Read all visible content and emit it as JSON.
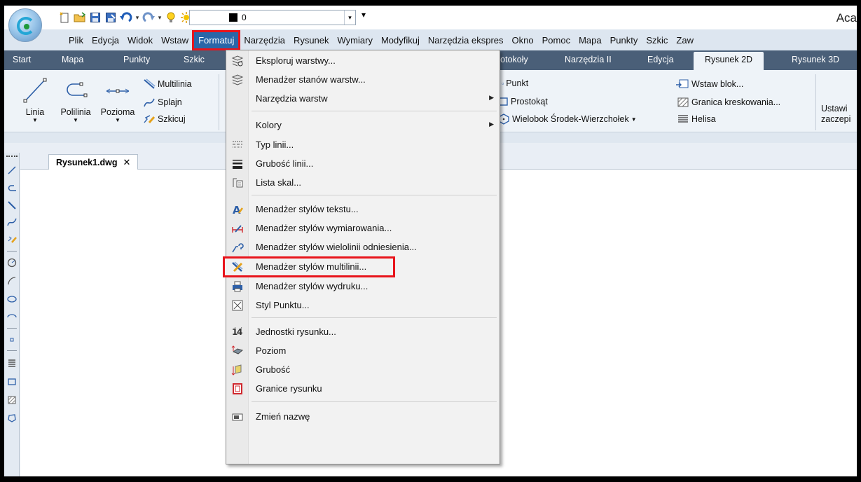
{
  "app": {
    "title": "Aca",
    "layer_value": "0",
    "qat_more": "▾"
  },
  "menubar": {
    "items": [
      "Plik",
      "Edycja",
      "Widok",
      "Wstaw",
      "Formatuj",
      "Narzędzia",
      "Rysunek",
      "Wymiary",
      "Modyfikuj",
      "Narzędzia ekspres",
      "Okno",
      "Pomoc",
      "Mapa",
      "Punkty",
      "Szkic",
      "Zaw"
    ],
    "active_index": 4
  },
  "ribbon_tabs": {
    "items": [
      "Start",
      "Mapa",
      "Punkty",
      "Szkic",
      "rotokoły",
      "Narzędzia II",
      "Edycja",
      "Rysunek 2D",
      "Rysunek 3D"
    ],
    "active_index": 7
  },
  "ribbon": {
    "linia": "Linia",
    "polilinia": "Polilinia",
    "pozioma": "Pozioma",
    "multilinia": "Multilinia",
    "splajn": "Splajn",
    "szkicuj": "Szkicuj",
    "punkt": "Punkt",
    "prostokat": "Prostokąt",
    "wielobok": "Wielobok Środek-Wierzchołek",
    "wstaw_blok": "Wstaw blok...",
    "granica": "Granica kreskowania...",
    "helisa": "Helisa",
    "ustaw_1": "Ustawi",
    "ustaw_2": "zaczepi"
  },
  "document": {
    "tab_name": "Rysunek1.dwg",
    "close_glyph": "✕"
  },
  "dropdown": {
    "items": [
      {
        "label": "Eksploruj warstwy...",
        "icon": "layer-explorer-icon"
      },
      {
        "label": "Menadżer stanów warstw...",
        "icon": "layer-states-icon"
      },
      {
        "label": "Narzędzia warstw",
        "icon": "",
        "submenu": true
      },
      {
        "label": "Kolory",
        "icon": "",
        "submenu": true
      },
      {
        "label": "Typ linii...",
        "icon": "linetype-icon"
      },
      {
        "label": "Grubość linii...",
        "icon": "lineweight-icon"
      },
      {
        "label": "Lista skal...",
        "icon": "scale-list-icon"
      },
      {
        "label": "Menadżer stylów tekstu...",
        "icon": "text-style-icon"
      },
      {
        "label": "Menadżer stylów wymiarowania...",
        "icon": "dim-style-icon"
      },
      {
        "label": "Menadżer stylów wielolinii odniesienia...",
        "icon": "mleader-style-icon"
      },
      {
        "label": "Menadżer stylów multilinii...",
        "icon": "mline-style-icon",
        "highlighted": true
      },
      {
        "label": "Menadżer stylów wydruku...",
        "icon": "plot-style-icon"
      },
      {
        "label": "Styl Punktu...",
        "icon": "point-style-icon"
      },
      {
        "label": "Jednostki rysunku...",
        "icon": "units-icon"
      },
      {
        "label": "Poziom",
        "icon": "elevation-icon"
      },
      {
        "label": "Grubość",
        "icon": "thickness-icon"
      },
      {
        "label": "Granice rysunku",
        "icon": "limits-icon"
      },
      {
        "label": "Zmień nazwę",
        "icon": "rename-icon"
      }
    ],
    "submenu_arrow": "▶"
  },
  "colors": {
    "highlight_border": "#e8141b",
    "menu_active_bg": "#2a66a8",
    "ribbon_tabs_bg": "#4a5f78"
  }
}
